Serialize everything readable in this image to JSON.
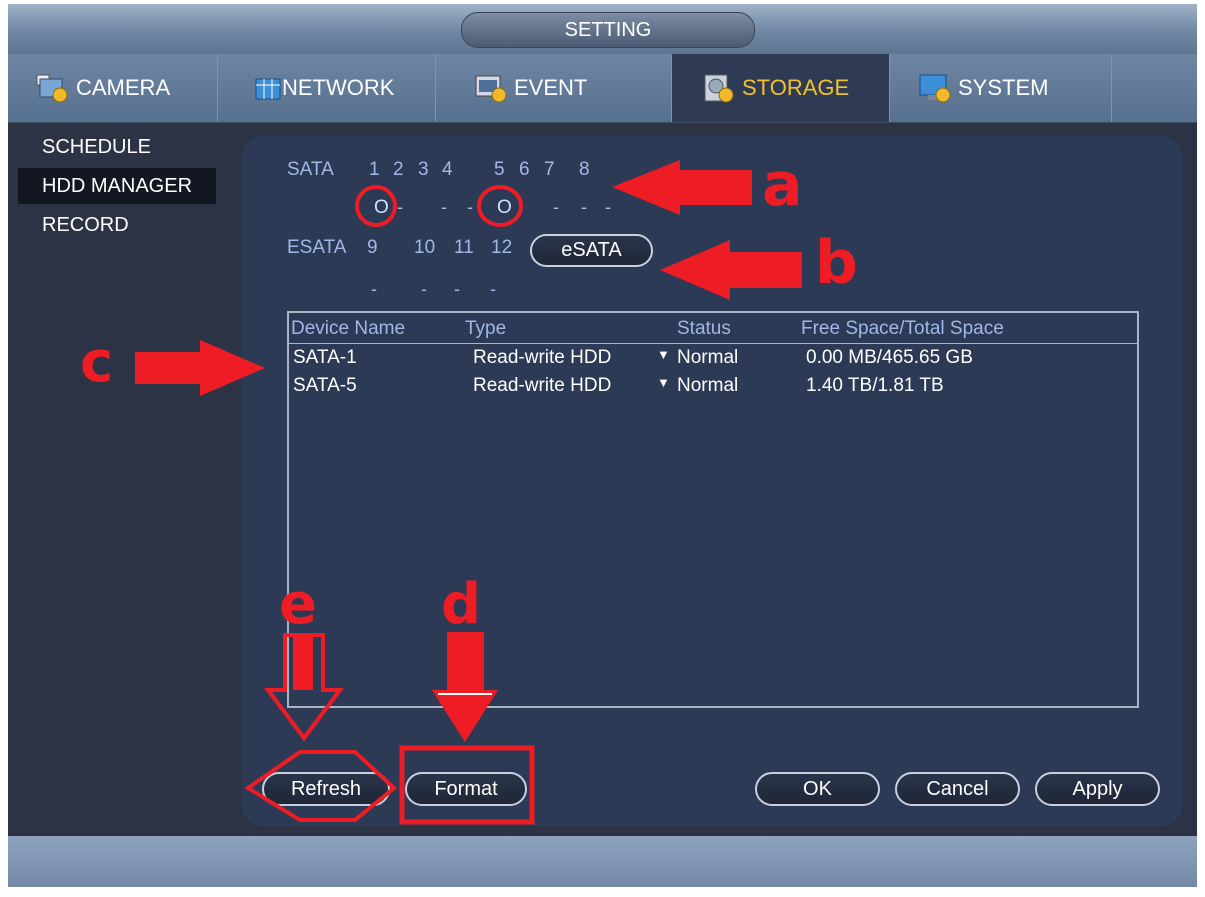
{
  "window": {
    "title": "SETTING"
  },
  "tabs": [
    {
      "label": "CAMERA",
      "icon": "camera-settings-icon"
    },
    {
      "label": "NETWORK",
      "icon": "network-icon"
    },
    {
      "label": "EVENT",
      "icon": "event-icon"
    },
    {
      "label": "STORAGE",
      "icon": "storage-icon",
      "active": true
    },
    {
      "label": "SYSTEM",
      "icon": "system-monitor-icon"
    }
  ],
  "sidebar": {
    "items": [
      {
        "label": "SCHEDULE"
      },
      {
        "label": "HDD MANAGER",
        "active": true
      },
      {
        "label": "RECORD"
      }
    ]
  },
  "sata": {
    "label": "SATA",
    "ports": [
      "1",
      "2",
      "3",
      "4",
      "5",
      "6",
      "7",
      "8"
    ],
    "states": [
      "O",
      "-",
      "-",
      "-",
      "O",
      "-",
      "-",
      "-"
    ]
  },
  "esata": {
    "label": "ESATA",
    "ports": [
      "9",
      "10",
      "11",
      "12"
    ],
    "states": [
      "-",
      "-",
      "-",
      "-"
    ],
    "button": "eSATA"
  },
  "table": {
    "headers": [
      "Device Name",
      "Type",
      "Status",
      "Free Space/Total Space"
    ],
    "rows": [
      {
        "device": "SATA-1",
        "type": "Read-write HDD",
        "status": "Normal",
        "space": "0.00 MB/465.65 GB"
      },
      {
        "device": "SATA-5",
        "type": "Read-write HDD",
        "status": "Normal",
        "space": "1.40 TB/1.81 TB"
      }
    ]
  },
  "buttons": {
    "refresh": "Refresh",
    "format": "Format",
    "ok": "OK",
    "cancel": "Cancel",
    "apply": "Apply"
  },
  "annotations": {
    "a": "a",
    "b": "b",
    "c": "c",
    "d": "d",
    "e": "e"
  },
  "colors": {
    "accent": "#f2c22a",
    "annotation": "#ee1c24",
    "panel": "#2d3a55",
    "text_blue": "#9fb8e8"
  }
}
